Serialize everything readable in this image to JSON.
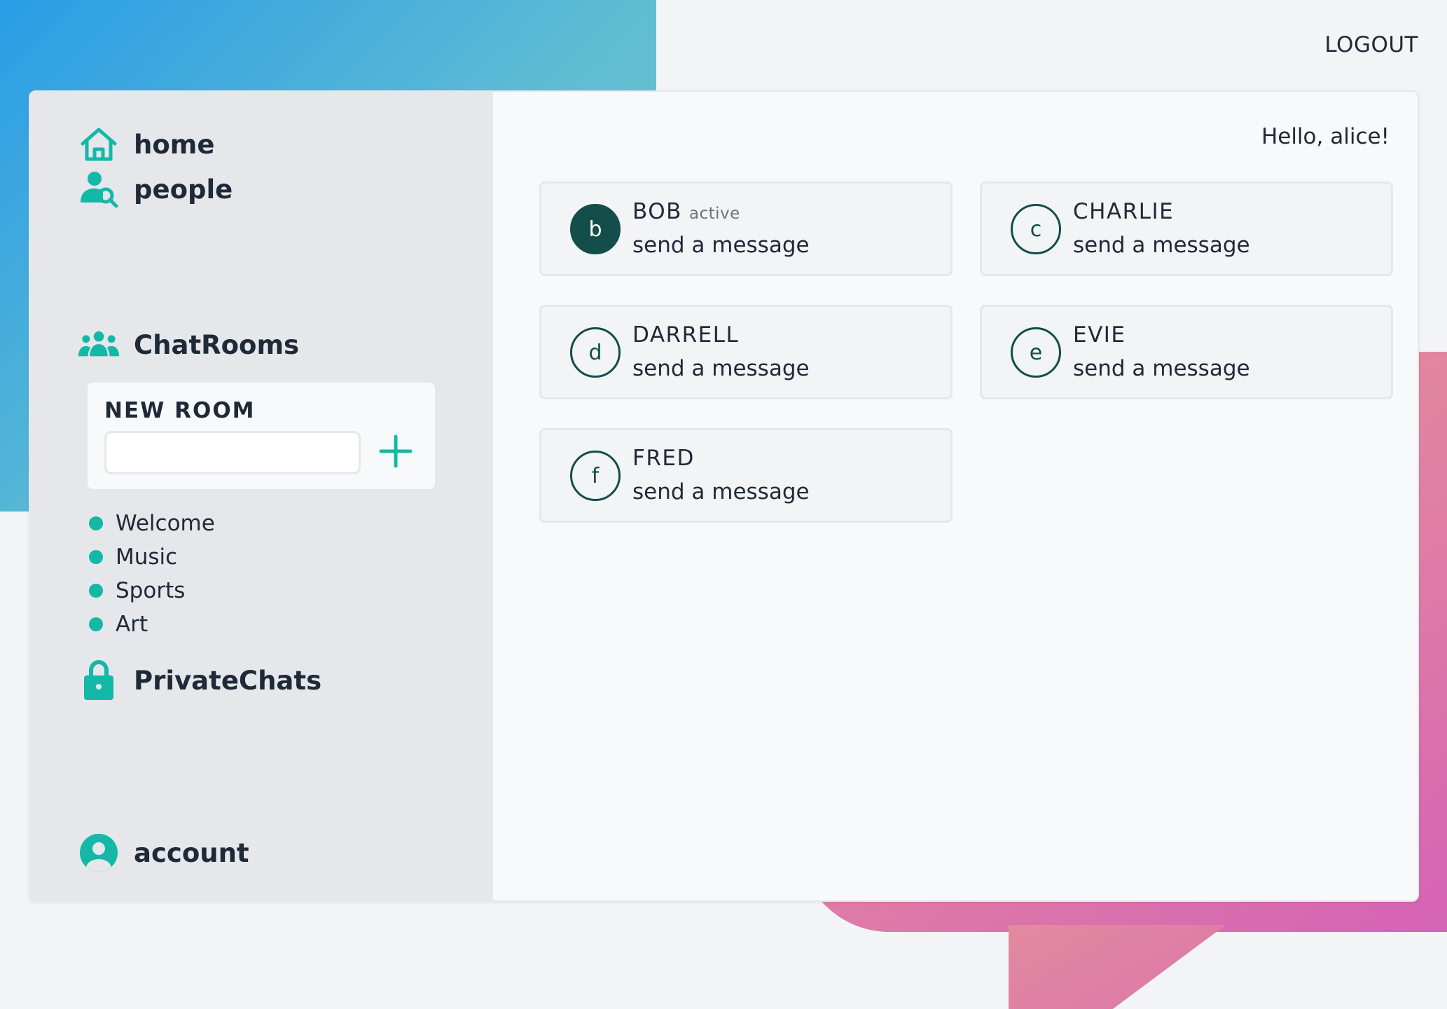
{
  "header": {
    "logout_label": "LOGOUT"
  },
  "sidebar": {
    "nav": [
      {
        "label": "home",
        "icon": "home-icon"
      },
      {
        "label": "people",
        "icon": "people-search-icon"
      }
    ],
    "chatrooms": {
      "label": "ChatRooms",
      "icon": "group-icon",
      "new_room_title": "NEW ROOM",
      "new_room_value": "",
      "add_icon": "plus-icon",
      "rooms": [
        "Welcome",
        "Music",
        "Sports",
        "Art"
      ]
    },
    "private": {
      "label": "PrivateChats",
      "icon": "lock-icon"
    },
    "account": {
      "label": "account",
      "icon": "account-icon"
    }
  },
  "main": {
    "greeting": "Hello, alice!",
    "users": [
      {
        "initial": "b",
        "name": "BOB",
        "status": "active",
        "action": "send a message"
      },
      {
        "initial": "c",
        "name": "CHARLIE",
        "status": "",
        "action": "send a message"
      },
      {
        "initial": "d",
        "name": "DARRELL",
        "status": "",
        "action": "send a message"
      },
      {
        "initial": "e",
        "name": "EVIE",
        "status": "",
        "action": "send a message"
      },
      {
        "initial": "f",
        "name": "FRED",
        "status": "",
        "action": "send a message"
      }
    ]
  },
  "colors": {
    "accent": "#14b8a6",
    "avatar_dark": "#134e4a",
    "sidebar_bg": "#e5e7eb"
  }
}
